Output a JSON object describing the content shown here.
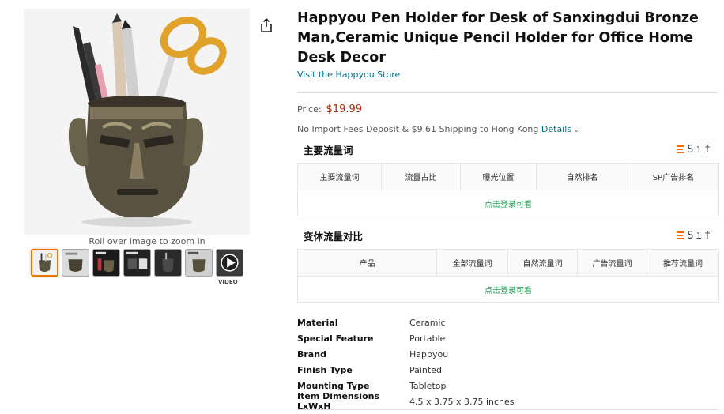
{
  "product": {
    "title": "Happyou Pen Holder for Desk of Sanxingdui Bronze Man,Ceramic Unique Pencil Holder for Office Home Desk Decor",
    "store_link": "Visit the Happyou Store",
    "price_label": "Price:",
    "price": "$19.99",
    "shipping_text": "No Import Fees Deposit & $9.61 Shipping to Hong Kong",
    "details_link": "Details"
  },
  "gallery": {
    "zoom_hint": "Roll over image to zoom in",
    "video_label": "VIDEO",
    "thumbnail_count": 7,
    "active_index": 0
  },
  "panels": {
    "keywords": {
      "title": "主要流量词",
      "brand": "Sif",
      "columns": [
        "主要流量词",
        "流量占比",
        "曝光位置",
        "自然排名",
        "SP广告排名"
      ],
      "login_prompt": "点击登录可看"
    },
    "variants": {
      "title": "变体流量对比",
      "brand": "Sif",
      "columns": [
        "产品",
        "全部流量词",
        "自然流量词",
        "广告流量词",
        "推荐流量词"
      ],
      "login_prompt": "点击登录可看"
    }
  },
  "specs": [
    {
      "key": "Material",
      "value": "Ceramic"
    },
    {
      "key": "Special Feature",
      "value": "Portable"
    },
    {
      "key": "Brand",
      "value": "Happyou"
    },
    {
      "key": "Finish Type",
      "value": "Painted"
    },
    {
      "key": "Mounting Type",
      "value": "Tabletop"
    },
    {
      "key": "Item Dimensions LxWxH",
      "value": "4.5 x 3.75 x 3.75 inches"
    }
  ],
  "colors": {
    "price": "#b12704",
    "link": "#007185",
    "login_prompt": "#1a9a4d",
    "brand_accent": "#ff6a00",
    "active_thumb": "#e77600"
  }
}
